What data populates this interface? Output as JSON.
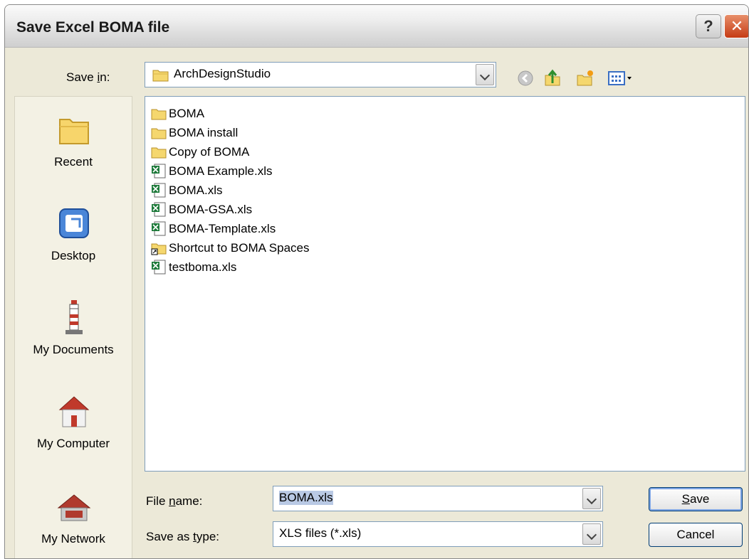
{
  "window": {
    "title": "Save Excel BOMA file",
    "help_glyph": "?",
    "close_glyph": "✕"
  },
  "savein": {
    "label_pre": "Save ",
    "label_ul": "i",
    "label_post": "n:",
    "value": "ArchDesignStudio",
    "icons": [
      "back-icon",
      "up-folder-icon",
      "new-folder-icon",
      "views-menu-icon"
    ]
  },
  "places": [
    {
      "label": "Recent",
      "icon": "recent-folder-icon"
    },
    {
      "label": "Desktop",
      "icon": "desktop-icon"
    },
    {
      "label": "My Documents",
      "icon": "my-documents-icon"
    },
    {
      "label": "My Computer",
      "icon": "my-computer-icon"
    },
    {
      "label": "My Network",
      "icon": "my-network-icon"
    }
  ],
  "files": [
    {
      "name": "BOMA",
      "type": "folder"
    },
    {
      "name": "BOMA install",
      "type": "folder"
    },
    {
      "name": "Copy of BOMA",
      "type": "folder"
    },
    {
      "name": "BOMA Example.xls",
      "type": "excel"
    },
    {
      "name": "BOMA.xls",
      "type": "excel"
    },
    {
      "name": "BOMA-GSA.xls",
      "type": "excel"
    },
    {
      "name": "BOMA-Template.xls",
      "type": "excel"
    },
    {
      "name": "Shortcut to BOMA Spaces",
      "type": "shortcut"
    },
    {
      "name": "testboma.xls",
      "type": "excel"
    }
  ],
  "filename": {
    "label_pre": "File ",
    "label_ul": "n",
    "label_post": "ame:",
    "value": "BOMA.xls"
  },
  "filetype": {
    "label_pre": "Save as ",
    "label_ul": "t",
    "label_post": "ype:",
    "value": "XLS files (*.xls)"
  },
  "buttons": {
    "save_ul": "S",
    "save_rest": "ave",
    "cancel": "Cancel"
  },
  "colors": {
    "selection": "#316ac5",
    "accent": "#7f9db9",
    "excel_green": "#1d7a3a",
    "folder_yellow": "#f5d76e"
  }
}
